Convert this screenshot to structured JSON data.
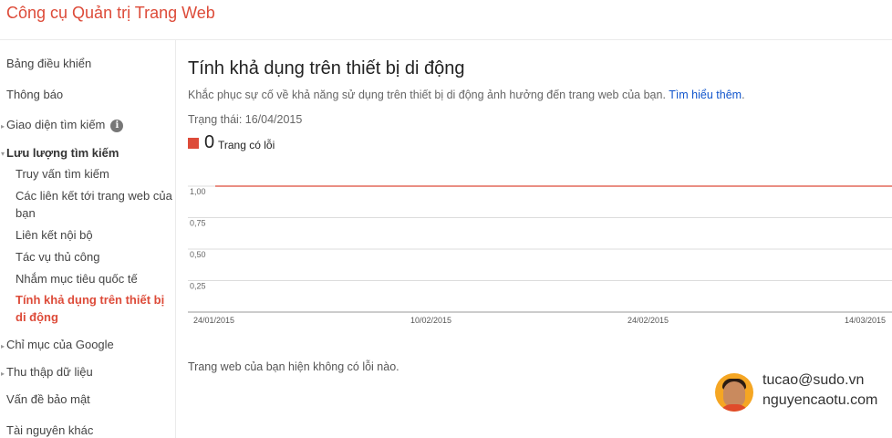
{
  "header": {
    "title": "Công cụ Quản trị Trang Web"
  },
  "sidebar": {
    "items": [
      {
        "label": "Bảng điều khiển"
      },
      {
        "label": "Thông báo"
      },
      {
        "label": "Giao diện tìm kiếm",
        "icon": "info-icon"
      },
      {
        "label": "Lưu lượng tìm kiếm",
        "expanded": true
      },
      {
        "label": "Chỉ mục của Google"
      },
      {
        "label": "Thu thập dữ liệu"
      },
      {
        "label": "Vấn đề bảo mật"
      },
      {
        "label": "Tài nguyên khác"
      }
    ],
    "subitems": [
      {
        "label": "Truy vấn tìm kiếm"
      },
      {
        "label": "Các liên kết tới trang web của bạn"
      },
      {
        "label": "Liên kết nội bộ"
      },
      {
        "label": "Tác vụ thủ công"
      },
      {
        "label": "Nhắm mục tiêu quốc tế"
      },
      {
        "label": "Tính khả dụng trên thiết bị di động",
        "active": true
      }
    ]
  },
  "main": {
    "title": "Tính khả dụng trên thiết bị di động",
    "description": "Khắc phục sự cố về khả năng sử dụng trên thiết bị di động ảnh hưởng đến trang web của bạn.",
    "learn_more": "Tìm hiểu thêm",
    "status": "Trạng thái: 16/04/2015",
    "legend_count": "0",
    "legend_label": "Trang có lỗi",
    "note": "Trang web của bạn hiện không có lỗi nào."
  },
  "chart_data": {
    "type": "line",
    "categories": [
      "24/01/2015",
      "10/02/2015",
      "24/02/2015",
      "14/03/2015"
    ],
    "y_ticks": [
      "1,00",
      "0,75",
      "0,50",
      "0,25"
    ],
    "ylim": [
      0,
      1
    ],
    "grid": true,
    "series": [
      {
        "name": "Trang có lỗi",
        "color": "#dd4b39",
        "points": [
          [
            0,
            1.0
          ],
          [
            1,
            1.0
          ]
        ]
      }
    ]
  },
  "watermark": {
    "line1": "tucao@sudo.vn",
    "line2": "nguyencaotu.com"
  },
  "colors": {
    "accent": "#dd4b39",
    "link": "#1155cc"
  }
}
